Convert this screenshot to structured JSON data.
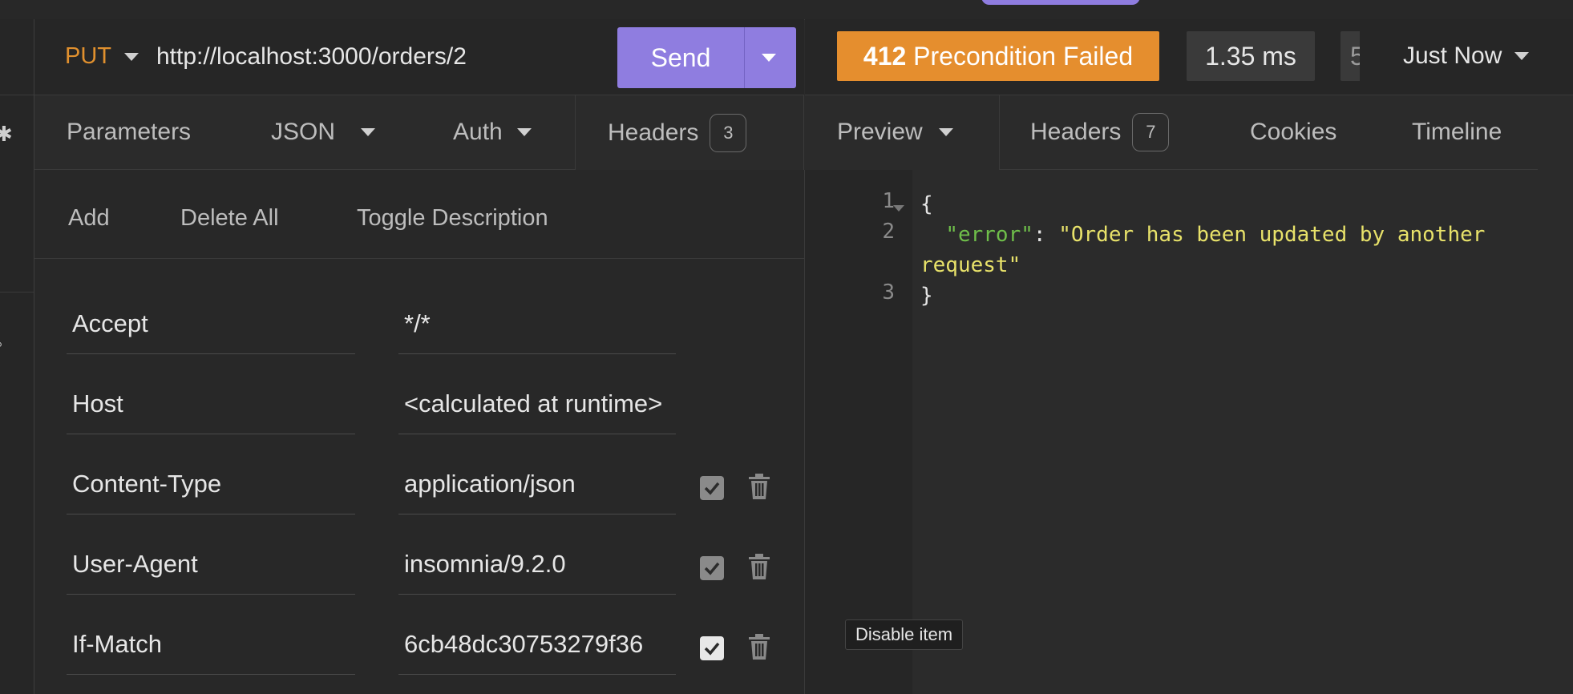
{
  "request": {
    "method": "PUT",
    "url": "http://localhost:3000/orders/2",
    "send_label": "Send"
  },
  "response": {
    "status_code": "412",
    "status_text": "Precondition Failed",
    "time": "1.35 ms",
    "size_partial": "5",
    "history_label": "Just Now"
  },
  "request_tabs": [
    {
      "label": "Parameters"
    },
    {
      "label": "JSON"
    },
    {
      "label": "Auth"
    },
    {
      "label": "Headers",
      "badge": "3"
    }
  ],
  "header_actions": {
    "add": "Add",
    "delete_all": "Delete All",
    "toggle_description": "Toggle Description"
  },
  "headers": [
    {
      "name": "Accept",
      "value": "*/*"
    },
    {
      "name": "Host",
      "value": "<calculated at runtime>"
    },
    {
      "name": "Content-Type",
      "value": "application/json",
      "enabled": true
    },
    {
      "name": "User-Agent",
      "value": "insomnia/9.2.0",
      "enabled": true
    },
    {
      "name": "If-Match",
      "value": "6cb48dc30753279f36",
      "enabled": true
    }
  ],
  "response_tabs": [
    {
      "label": "Preview"
    },
    {
      "label": "Headers",
      "badge": "7"
    },
    {
      "label": "Cookies"
    },
    {
      "label": "Timeline"
    }
  ],
  "response_body": {
    "line_numbers": [
      "1",
      "2",
      "3"
    ],
    "open_brace": "{",
    "key": "\"error\"",
    "colon": ":",
    "value_part1": "\"Order has been updated by another",
    "value_part2": "request\"",
    "close_brace": "}"
  },
  "tooltip": "Disable item",
  "colors": {
    "accent": "#8f7de0",
    "status_warning": "#e58e2e",
    "method_put": "#e0902e",
    "json_key": "#6fbf4a",
    "json_string": "#e8e26a"
  }
}
